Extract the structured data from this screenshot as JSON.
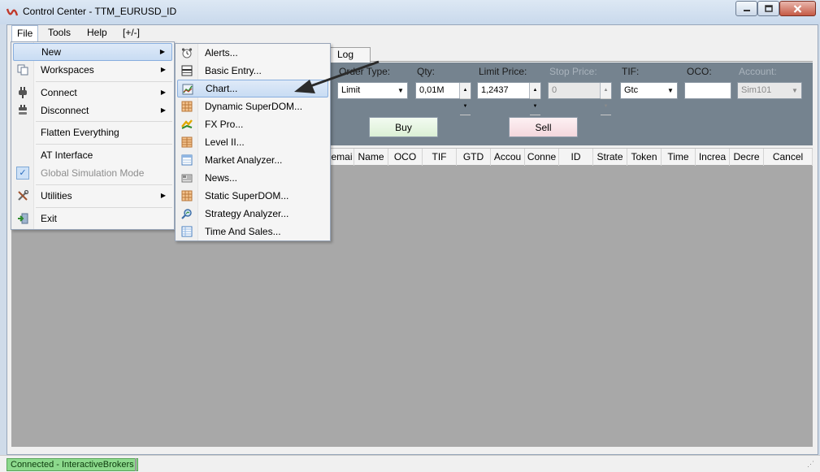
{
  "window": {
    "title": "Control Center - TTM_EURUSD_ID",
    "minimize_icon": "minimize-icon",
    "maximize_icon": "maximize-icon",
    "close_icon": "close-icon"
  },
  "menubar": {
    "items": [
      {
        "label": "File"
      },
      {
        "label": "Tools"
      },
      {
        "label": "Help"
      },
      {
        "label": "[+/-]"
      }
    ]
  },
  "tabs": {
    "log": "Log"
  },
  "order_entry": {
    "labels": {
      "order_type": "Order Type:",
      "qty": "Qty:",
      "limit_price": "Limit Price:",
      "stop_price": "Stop Price:",
      "tif": "TIF:",
      "oco": "OCO:",
      "account": "Account:"
    },
    "values": {
      "order_type": "Limit",
      "qty": "0,01M",
      "limit_price": "1,2437",
      "stop_price": "0",
      "tif": "Gtc",
      "oco": "",
      "account": "Sim101"
    },
    "buy_label": "Buy",
    "sell_label": "Sell",
    "buy_color": "#dbf0d5",
    "sell_color": "#f4d7dd"
  },
  "grid": {
    "columns": [
      "emai",
      "Name",
      "OCO",
      "TIF",
      "GTD",
      "Accou",
      "Conne",
      "ID",
      "Strate",
      "Token",
      "Time",
      "Increa",
      "Decre",
      "Cancel"
    ]
  },
  "file_menu": {
    "items": [
      {
        "label": "New",
        "icon": "",
        "submenu": true,
        "highlighted": true
      },
      {
        "label": "Workspaces",
        "icon": "copy-icon",
        "submenu": true
      },
      {
        "label": "Connect",
        "icon": "plug-icon",
        "submenu": true
      },
      {
        "label": "Disconnect",
        "icon": "unplug-icon",
        "submenu": true
      },
      {
        "label": "Flatten Everything",
        "icon": ""
      },
      {
        "label": "AT Interface",
        "icon": ""
      },
      {
        "label": "Global Simulation Mode",
        "icon": "check-icon",
        "disabled": true,
        "checked": true
      },
      {
        "label": "Utilities",
        "icon": "tools-icon",
        "submenu": true
      },
      {
        "label": "Exit",
        "icon": "exit-icon"
      }
    ]
  },
  "new_menu": {
    "items": [
      {
        "label": "Alerts...",
        "icon": "alarm-clock-icon"
      },
      {
        "label": "Basic Entry...",
        "icon": "basic-entry-icon"
      },
      {
        "label": "Chart...",
        "icon": "chart-icon",
        "highlighted": true
      },
      {
        "label": "Dynamic SuperDOM...",
        "icon": "superdom-icon"
      },
      {
        "label": "FX Pro...",
        "icon": "fx-pro-icon"
      },
      {
        "label": "Level II...",
        "icon": "level-two-icon"
      },
      {
        "label": "Market Analyzer...",
        "icon": "market-analyzer-icon"
      },
      {
        "label": "News...",
        "icon": "news-icon"
      },
      {
        "label": "Static SuperDOM...",
        "icon": "static-superdom-icon"
      },
      {
        "label": "Strategy Analyzer...",
        "icon": "strategy-analyzer-icon"
      },
      {
        "label": "Time And Sales...",
        "icon": "time-and-sales-icon"
      }
    ]
  },
  "statusbar": {
    "connection": "Connected - InteractiveBrokers",
    "connection_color": "#8cd98c"
  }
}
